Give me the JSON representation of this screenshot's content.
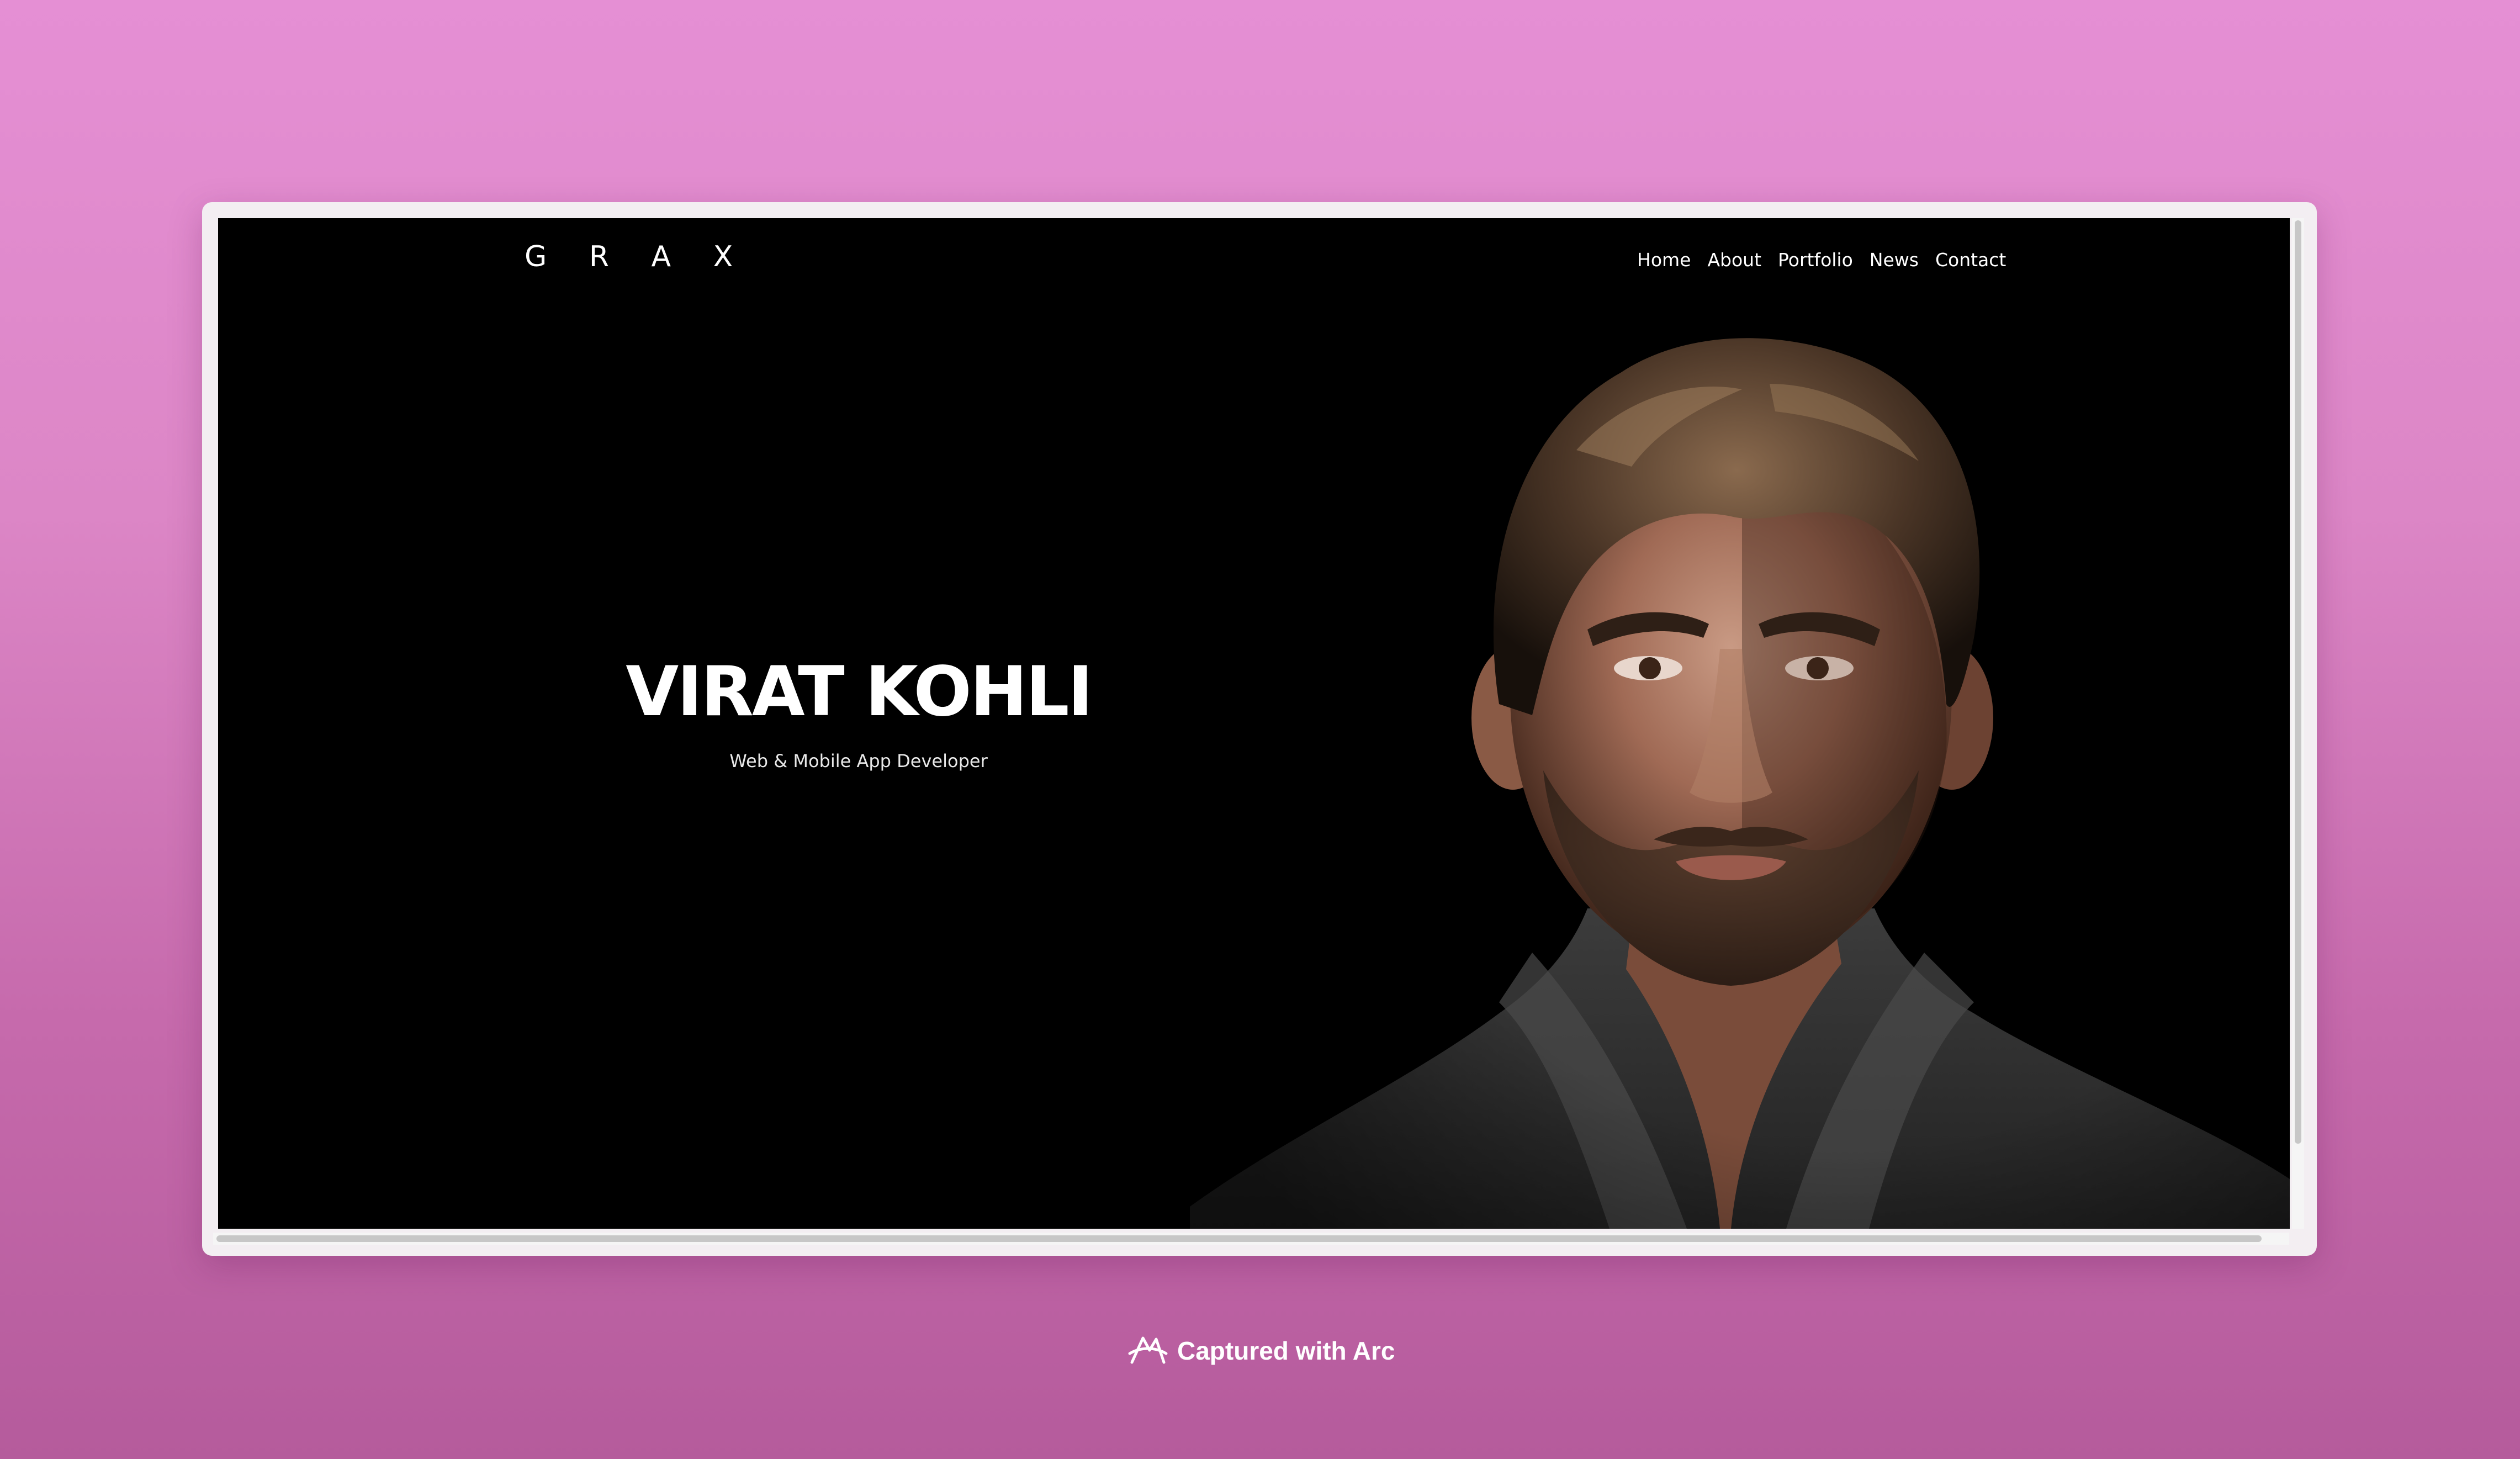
{
  "site": {
    "logo": "G R A X",
    "nav": [
      "Home",
      "About",
      "Portfolio",
      "News",
      "Contact"
    ]
  },
  "hero": {
    "name": "VIRAT KOHLI",
    "role": "Web & Mobile App Developer"
  },
  "caption": {
    "text": "Captured with Arc",
    "icon": "arc-logo-icon"
  },
  "colors": {
    "background_top": "#e58fd4",
    "background_bottom": "#b55b9c",
    "page_background": "#000000",
    "text": "#ffffff"
  }
}
